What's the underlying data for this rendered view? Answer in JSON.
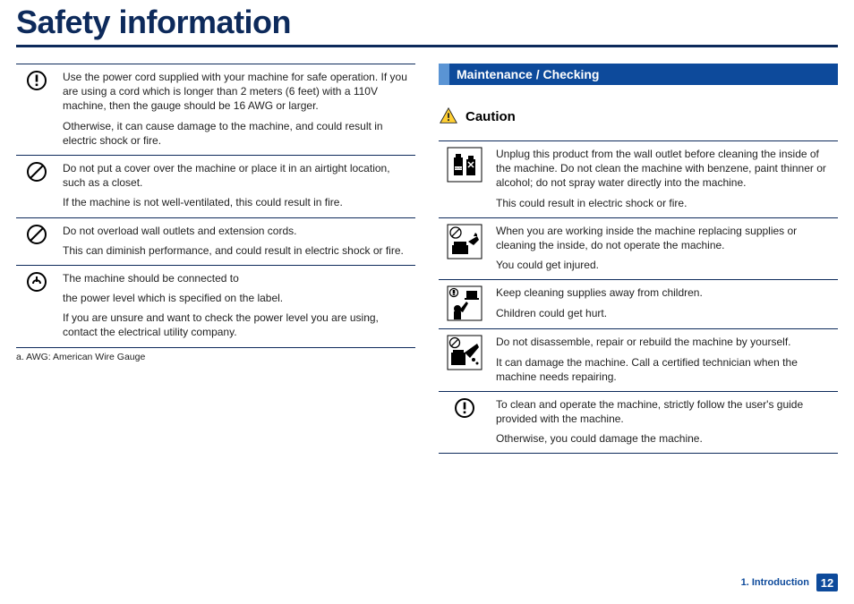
{
  "title": "Safety information",
  "left_rows": [
    {
      "icon": "warning-circle",
      "paras": [
        "Use the power cord supplied with your machine for safe operation. If you are using a cord which is longer than 2 meters (6 feet) with a 110V machine, then the gauge should be 16 AWG or larger.",
        "Otherwise, it can cause damage to the machine, and could result in electric shock or fire."
      ]
    },
    {
      "icon": "prohibit",
      "paras": [
        "Do not put a cover over the machine or place it in an airtight location, such as a closet.",
        "If the machine is not well-ventilated, this could result in fire."
      ]
    },
    {
      "icon": "prohibit",
      "paras": [
        "Do not overload wall outlets and extension cords.",
        "This can diminish performance, and could result in electric shock or fire."
      ]
    },
    {
      "icon": "power-label",
      "paras": [
        "The machine should be connected to",
        "the power level which is specified on the label.",
        "If you are unsure and want to check the power level you are using, contact the electrical utility company."
      ]
    }
  ],
  "footnote": "a.  AWG: American Wire Gauge",
  "section_bar": "Maintenance / Checking",
  "caution_label": "Caution",
  "right_rows": [
    {
      "icon": "chemicals",
      "paras": [
        "Unplug this product from the wall outlet before cleaning the inside of the machine. Do not clean the machine with benzene, paint thinner or alcohol; do not spray water directly into the machine.",
        "This could result in electric shock or fire."
      ]
    },
    {
      "icon": "hand-machine",
      "paras": [
        "When you are working inside the machine replacing supplies or cleaning the inside, do not operate the machine.",
        "You could get injured."
      ]
    },
    {
      "icon": "child-reach",
      "paras": [
        "Keep cleaning supplies away from children.",
        "Children could get hurt."
      ]
    },
    {
      "icon": "no-disassemble",
      "paras": [
        "Do not disassemble, repair or rebuild the machine by yourself.",
        "It can damage the machine. Call a certified technician when the machine needs repairing."
      ]
    },
    {
      "icon": "warning-circle",
      "paras": [
        "To clean and operate the machine, strictly follow the user's guide provided with the machine.",
        "Otherwise, you could damage the machine."
      ]
    }
  ],
  "footer_chapter": "1. Introduction",
  "footer_page": "12",
  "icons": {
    "warning-circle": "exclaim",
    "prohibit": "prohibit",
    "power-label": "power",
    "chemicals": "chem",
    "hand-machine": "hand",
    "child-reach": "child",
    "no-disassemble": "disas"
  }
}
